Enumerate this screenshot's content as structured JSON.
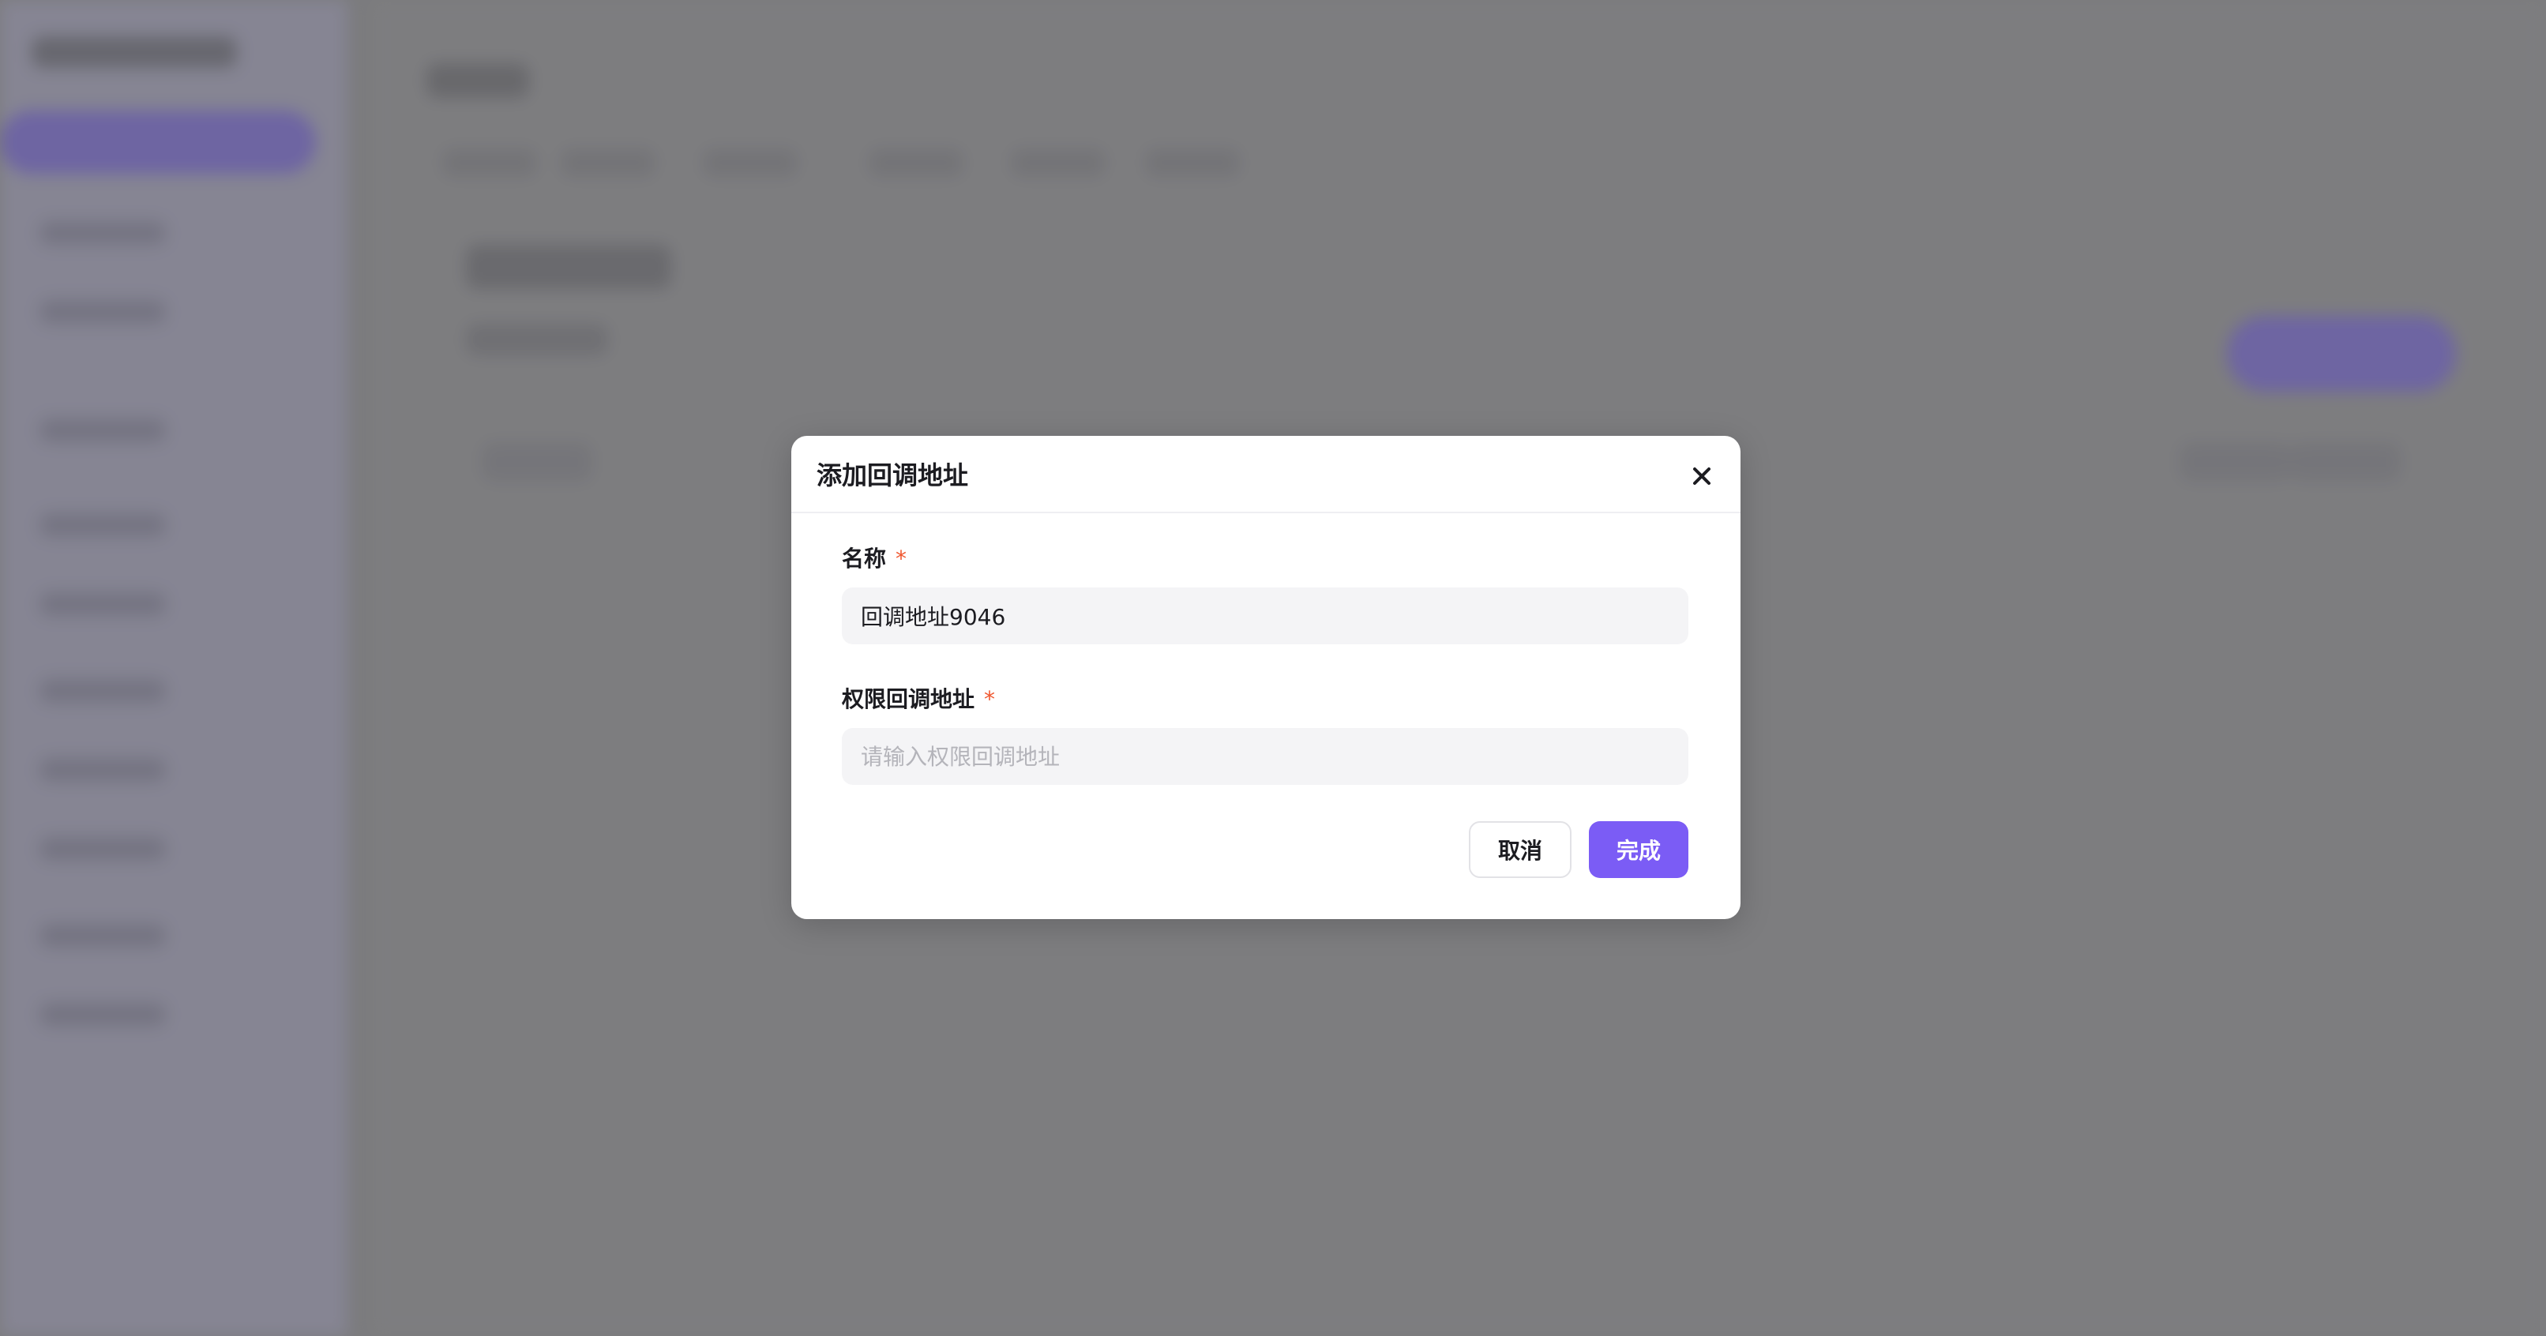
{
  "dialog": {
    "title": "添加回调地址",
    "close_icon": "close-icon",
    "fields": [
      {
        "label": "名称",
        "required_mark": "*",
        "value": "回调地址9046",
        "placeholder": ""
      },
      {
        "label": "权限回调地址",
        "required_mark": "*",
        "value": "",
        "placeholder": "请输入权限回调地址"
      }
    ],
    "cancel_label": "取消",
    "confirm_label": "完成"
  },
  "colors": {
    "accent": "#7b5cf5",
    "required": "#f0572f",
    "overlay": "#8a8a8c"
  }
}
